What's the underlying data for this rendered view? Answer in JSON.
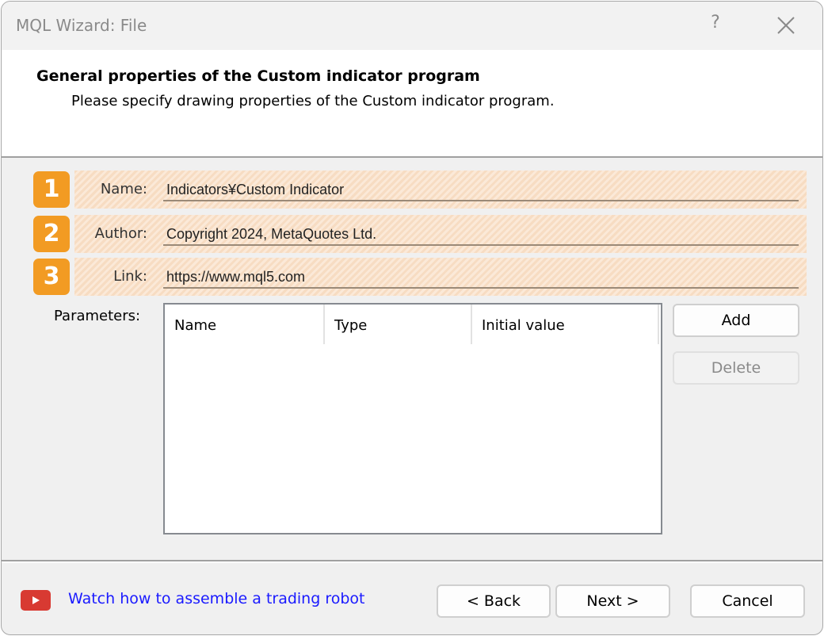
{
  "window": {
    "title": "MQL Wizard: File",
    "help_label": "?",
    "close_icon": "close-icon"
  },
  "header": {
    "title": "General properties of the Custom indicator program",
    "subtitle": "Please specify drawing properties of the Custom indicator program."
  },
  "fields": [
    {
      "badge": "1",
      "label": "Name:",
      "value": "Indicators¥Custom Indicator"
    },
    {
      "badge": "2",
      "label": "Author:",
      "value": "Copyright 2024, MetaQuotes Ltd."
    },
    {
      "badge": "3",
      "label": "Link:",
      "value": "https://www.mql5.com"
    }
  ],
  "parameters": {
    "label": "Parameters:",
    "columns": [
      "Name",
      "Type",
      "Initial value"
    ],
    "rows": [],
    "add_label": "Add",
    "delete_label": "Delete"
  },
  "footer": {
    "video_icon": "youtube-play-icon",
    "video_link": "Watch how to assemble a trading robot",
    "back_label": "< Back",
    "next_label": "Next >",
    "cancel_label": "Cancel"
  },
  "colors": {
    "badge": "#f29b23",
    "highlight_stripe": "#f7dcc2",
    "link": "#1a1aff",
    "youtube_red": "#d83a32"
  }
}
